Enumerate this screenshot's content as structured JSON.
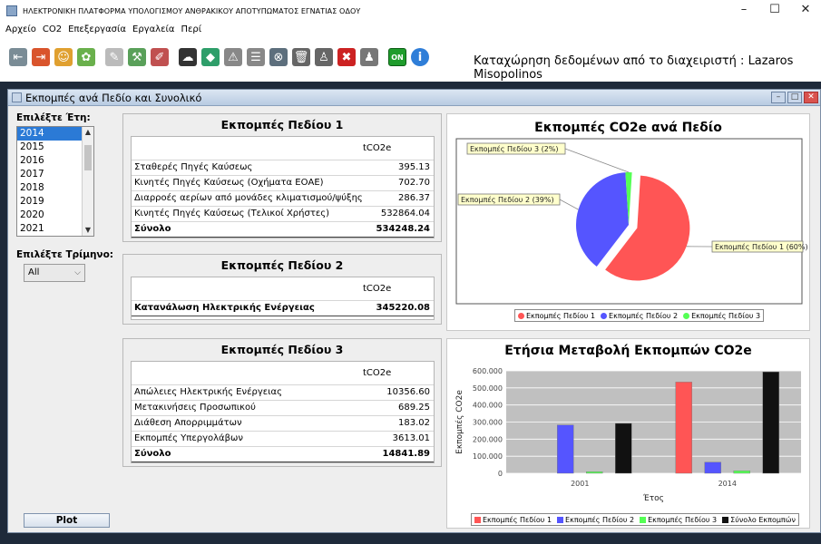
{
  "window": {
    "title": "ΗΛΕΚΤΡΟΝΙΚΗ ΠΛΑΤΦΟΡΜΑ ΥΠΟΛΟΓΙΣΜΟΥ ΑΝΘΡΑΚΙΚΟΥ ΑΠΟΤΥΠΩΜΑΤΟΣ ΕΓΝΑΤΙΑΣ ΟΔΟΥ",
    "minimize": "–",
    "maximize": "☐",
    "close": "✕"
  },
  "menu": [
    "Αρχείο",
    "CO2",
    "Επεξεργασία",
    "Εργαλεία",
    "Περί"
  ],
  "toolbar": {
    "user_text": "Καταχώρηση δεδομένων από το διαχειριστή : Lazaros Misopolinos",
    "on_label": "ON",
    "icons": [
      {
        "name": "exit-icon",
        "color": "#7a8c96",
        "glyph": "⇤"
      },
      {
        "name": "logout-icon",
        "color": "#d9542c",
        "glyph": "⇥"
      },
      {
        "name": "users-icon",
        "color": "#e0a030",
        "glyph": "☺"
      },
      {
        "name": "settings-icon",
        "color": "#6ab04c",
        "glyph": "✿"
      },
      {
        "name": "edit-icon",
        "color": "#bbbbbb",
        "glyph": "✎"
      },
      {
        "name": "tools-icon",
        "color": "#5aa05a",
        "glyph": "⚒"
      },
      {
        "name": "pen-icon",
        "color": "#c05050",
        "glyph": "✐"
      },
      {
        "name": "co2-cloud-icon",
        "color": "#333333",
        "glyph": "☁"
      },
      {
        "name": "emission-icon",
        "color": "#2e9e6a",
        "glyph": "◆"
      },
      {
        "name": "warning-icon",
        "color": "#888888",
        "glyph": "⚠"
      },
      {
        "name": "meter-icon",
        "color": "#888888",
        "glyph": "☰"
      },
      {
        "name": "cancel-icon",
        "color": "#5d6f7d",
        "glyph": "⊗"
      },
      {
        "name": "trash-icon",
        "color": "#666666",
        "glyph": "🗑"
      },
      {
        "name": "user-admin-icon",
        "color": "#666666",
        "glyph": "♙"
      },
      {
        "name": "delete-icon",
        "color": "#cc2222",
        "glyph": "✖"
      },
      {
        "name": "person-icon",
        "color": "#777777",
        "glyph": "♟"
      },
      {
        "name": "info-icon",
        "color": "#2f7ed8",
        "glyph": "i"
      }
    ]
  },
  "frame": {
    "title": "Εκπομπές ανά Πεδίο και Συνολικό"
  },
  "left": {
    "years_label": "Επιλέξτε Έτη:",
    "years": [
      "2014",
      "2015",
      "2016",
      "2017",
      "2018",
      "2019",
      "2020",
      "2021"
    ],
    "selected_year": "2014",
    "quarter_label": "Επιλέξτε Τρίμηνο:",
    "quarter_value": "All",
    "plot_button": "Plot"
  },
  "field1": {
    "title": "Εκπομπές Πεδίου 1",
    "unit": "tCO2e",
    "rows": [
      {
        "name": "Σταθερές Πηγές Καύσεως",
        "value": "395.13"
      },
      {
        "name": "Κινητές Πηγές Καύσεως (Οχήματα ΕΟΑΕ)",
        "value": "702.70"
      },
      {
        "name": "Διαρροές αερίων από μονάδες κλιματισμού/ψύξης",
        "value": "286.37"
      },
      {
        "name": "Κινητές Πηγές Καύσεως (Τελικοί Χρήστες)",
        "value": "532864.04"
      }
    ],
    "total_label": "Σύνολο",
    "total_value": "534248.24"
  },
  "field2": {
    "title": "Εκπομπές Πεδίου 2",
    "unit": "tCO2e",
    "row_name": "Κατανάλωση Ηλεκτρικής Ενέργειας",
    "row_value": "345220.08"
  },
  "field3": {
    "title": "Εκπομπές Πεδίου 3",
    "unit": "tCO2e",
    "rows": [
      {
        "name": "Απώλειες Ηλεκτρικής Ενέργειας",
        "value": "10356.60"
      },
      {
        "name": "Μετακινήσεις Προσωπικού",
        "value": "689.25"
      },
      {
        "name": "Διάθεση Απορριμμάτων",
        "value": "183.02"
      },
      {
        "name": "Εκπομπές Υπεργολάβων",
        "value": "3613.01"
      }
    ],
    "total_label": "Σύνολο",
    "total_value": "14841.89"
  },
  "chart_data": [
    {
      "type": "pie",
      "title": "Εκπομπές CO2e ανά Πεδίο",
      "labels": [
        "Εκπομπές Πεδίου 1",
        "Εκπομπές Πεδίου 2",
        "Εκπομπές Πεδίου 3"
      ],
      "values": [
        60,
        39,
        2
      ],
      "slice_labels": [
        "Εκπομπές Πεδίου 1 (60%)",
        "Εκπομπές Πεδίου 2 (39%)",
        "Εκπομπές Πεδίου 3 (2%)"
      ],
      "colors": [
        "#ff5555",
        "#5555ff",
        "#55ff55"
      ],
      "legend": "bottom"
    },
    {
      "type": "bar",
      "title": "Ετήσια Μεταβολή Εκπομπών CO2e",
      "xlabel": "Έτος",
      "ylabel": "Εκπομπές CO2e",
      "categories": [
        "2001",
        "2014"
      ],
      "series": [
        {
          "name": "Εκπομπές Πεδίου 1",
          "color": "#ff5555",
          "values": [
            0,
            534248
          ]
        },
        {
          "name": "Εκπομπές Πεδίου 2",
          "color": "#5555ff",
          "values": [
            283000,
            65000
          ]
        },
        {
          "name": "Εκπομπές Πεδίου 3",
          "color": "#55ff55",
          "values": [
            9000,
            14842
          ]
        },
        {
          "name": "Σύνολο Εκπομπών",
          "color": "#111111",
          "values": [
            292000,
            594000
          ]
        }
      ],
      "ylim": [
        0,
        600000
      ],
      "yticks": [
        "0",
        "100.000",
        "200.000",
        "300.000",
        "400.000",
        "500.000",
        "600.000"
      ],
      "grid": true,
      "legend": "bottom"
    }
  ]
}
